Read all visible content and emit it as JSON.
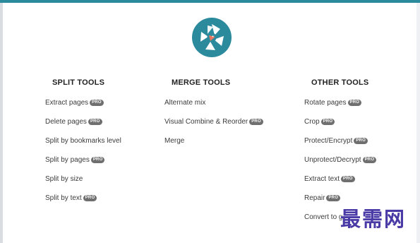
{
  "columns": {
    "split": {
      "title": "SPLIT TOOLS",
      "items": [
        {
          "label": "Extract pages",
          "pro": "PRO"
        },
        {
          "label": "Delete pages",
          "pro": "PRO"
        },
        {
          "label": "Split by bookmarks level",
          "pro": ""
        },
        {
          "label": "Split by pages",
          "pro": "PRO"
        },
        {
          "label": "Split by size",
          "pro": ""
        },
        {
          "label": "Split by text",
          "pro": "PRO"
        }
      ]
    },
    "merge": {
      "title": "MERGE TOOLS",
      "items": [
        {
          "label": "Alternate mix",
          "pro": ""
        },
        {
          "label": "Visual Combine & Reorder",
          "pro": "PRO"
        },
        {
          "label": "Merge",
          "pro": ""
        }
      ]
    },
    "other": {
      "title": "OTHER TOOLS",
      "items": [
        {
          "label": "Rotate pages",
          "pro": "PRO"
        },
        {
          "label": "Crop",
          "pro": "PRO"
        },
        {
          "label": "Protect/Encrypt",
          "pro": "PRO"
        },
        {
          "label": "Unprotect/Decrypt",
          "pro": "PRO"
        },
        {
          "label": "Extract text",
          "pro": "PRO"
        },
        {
          "label": "Repair",
          "pro": "PRO"
        },
        {
          "label": "Convert to g",
          "pro": ""
        }
      ]
    }
  },
  "watermark": {
    "text": "最需网"
  },
  "colors": {
    "brand": "#2b8a9c",
    "logo_accent": "#e8765f",
    "pro_badge": "#6f6f6f",
    "watermark": "#4a3aa6"
  },
  "icons": {
    "logo": "pdf-tool-shutter-logo-icon"
  }
}
